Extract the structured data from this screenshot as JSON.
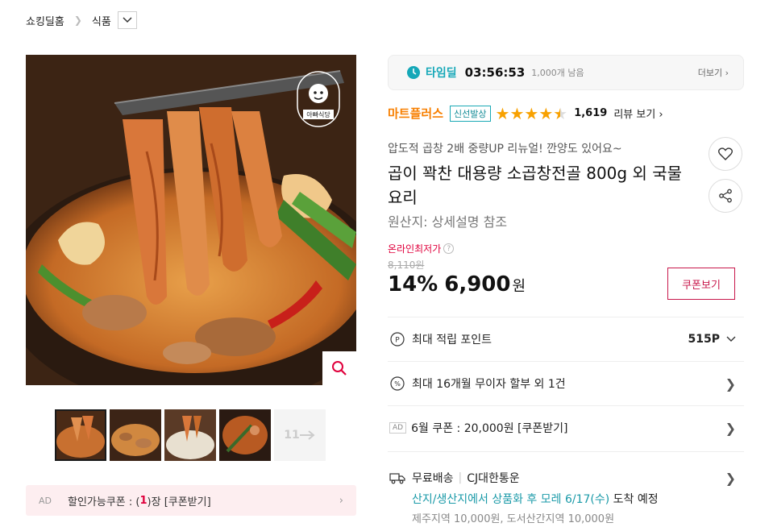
{
  "breadcrumb": {
    "home": "쇼킹딜홈",
    "category": "식품"
  },
  "gallery": {
    "logo_text": "아빠식당",
    "thumb_next_label": "11"
  },
  "ad_bar": {
    "ad_label": "AD",
    "text_before": "할인가능쿠폰 : (",
    "count": "1",
    "text_after": ")장 [쿠폰받기]"
  },
  "timedeal": {
    "label": "타임딜",
    "time": "03:56:53",
    "remaining": "1,000개 남음",
    "more": "더보기"
  },
  "seller": {
    "name": "마트플러스",
    "tag": "신선발상",
    "rating": 4.5,
    "review_count": "1,619",
    "review_link": "리뷰 보기"
  },
  "product": {
    "subtitle": "압도적 곱창 2배 중량UP 리뉴얼! 깐양도 있어요~",
    "title": "곱이 꽉찬 대용량 소곱창전골 800g 외 국물요리",
    "origin": "원산지:  상세설명 참조"
  },
  "price": {
    "lowest_label": "온라인최저가",
    "original": "8,110원",
    "discount": "14%",
    "value": "6,900",
    "unit": "원",
    "coupon_button": "쿠폰보기"
  },
  "info_rows": {
    "points_label": "최대 적립 포인트",
    "points_value": "515P",
    "installment_label": "최대 16개월 무이자 할부 외 1건",
    "coupon_ad": "AD",
    "coupon_label": "6월 쿠폰 : 20,000원 [쿠폰받기]"
  },
  "shipping": {
    "free": "무료배송",
    "carrier": "CJ대한통운",
    "eta_teal": "산지/생산지에서 상품화 후 모레 6/17(수)",
    "eta_rest": " 도착 예정",
    "extra": "제주지역 10,000원, 도서산간지역 10,000원"
  },
  "colors": {
    "accent_red": "#e0003c",
    "teal": "#15a8b8",
    "orange": "#f77f00",
    "star": "#f8a100"
  }
}
